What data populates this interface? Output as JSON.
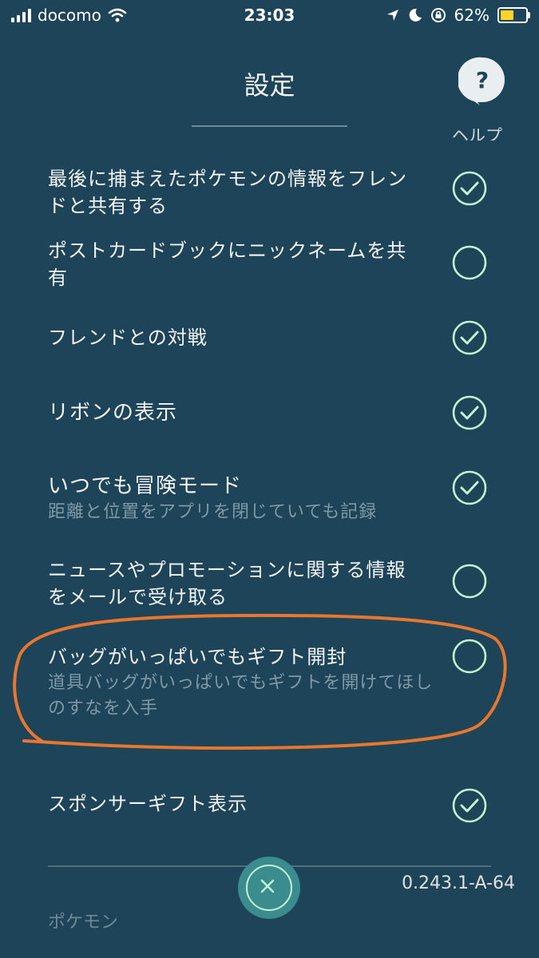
{
  "status": {
    "carrier": "docomo",
    "time": "23:03",
    "battery": "62%",
    "battery_level": 0.62
  },
  "header": {
    "title": "設定",
    "help_symbol": "?",
    "help_label": "ヘルプ"
  },
  "settings": [
    {
      "title": "最後に捕まえたポケモンの情報をフレンドと共有する",
      "description": "",
      "checked": true
    },
    {
      "title": "ポストカードブックにニックネームを共有",
      "description": "",
      "checked": false
    },
    {
      "title": "フレンドとの対戦",
      "description": "",
      "checked": true
    },
    {
      "title": "リボンの表示",
      "description": "",
      "checked": true
    },
    {
      "title": "いつでも冒険モード",
      "description": "距離と位置をアプリを閉じていても記録",
      "checked": true
    },
    {
      "title": "ニュースやプロモーションに関する情報をメールで受け取る",
      "description": "",
      "checked": false
    },
    {
      "title": "バッグがいっぱいでもギフト開封",
      "description": "道具バッグがいっぱいでもギフトを開けてほしのすなを入手",
      "checked": false
    },
    {
      "title": "スポンサーギフト表示",
      "description": "",
      "checked": true
    }
  ],
  "footer": {
    "version": "0.243.1-A-64",
    "section_label": "ポケモン"
  },
  "colors": {
    "background": "#1d4459",
    "check_accent": "#c3f3cf",
    "annotation": "#e8762e"
  }
}
